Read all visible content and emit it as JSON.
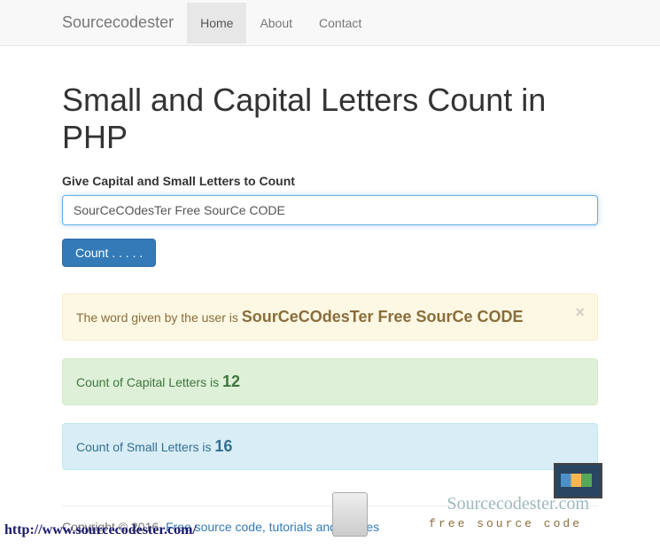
{
  "navbar": {
    "brand": "Sourcecodester",
    "items": [
      "Home",
      "About",
      "Contact"
    ]
  },
  "page": {
    "title": "Small and Capital Letters Count in PHP",
    "form_label": "Give Capital and Small Letters to Count",
    "input_value": "SourCeCOdesTer Free SourCe CODE",
    "button_label": "Count . . . . ."
  },
  "results": {
    "word_prefix": "The word given by the user is ",
    "word_value": "SourCeCOdesTer Free SourCe CODE",
    "capital_prefix": "Count of Capital Letters is ",
    "capital_count": "12",
    "small_prefix": "Count of Small Letters is ",
    "small_count": "16",
    "close_symbol": "×"
  },
  "footer": {
    "copyright": "Copyright © 2016, ",
    "link_text": "Free source code, tutorials and articles"
  },
  "watermark": {
    "url": "http://www.sourcecodester.com/",
    "logo_main": "Sourcecodester.com",
    "logo_sub": "free source code"
  }
}
